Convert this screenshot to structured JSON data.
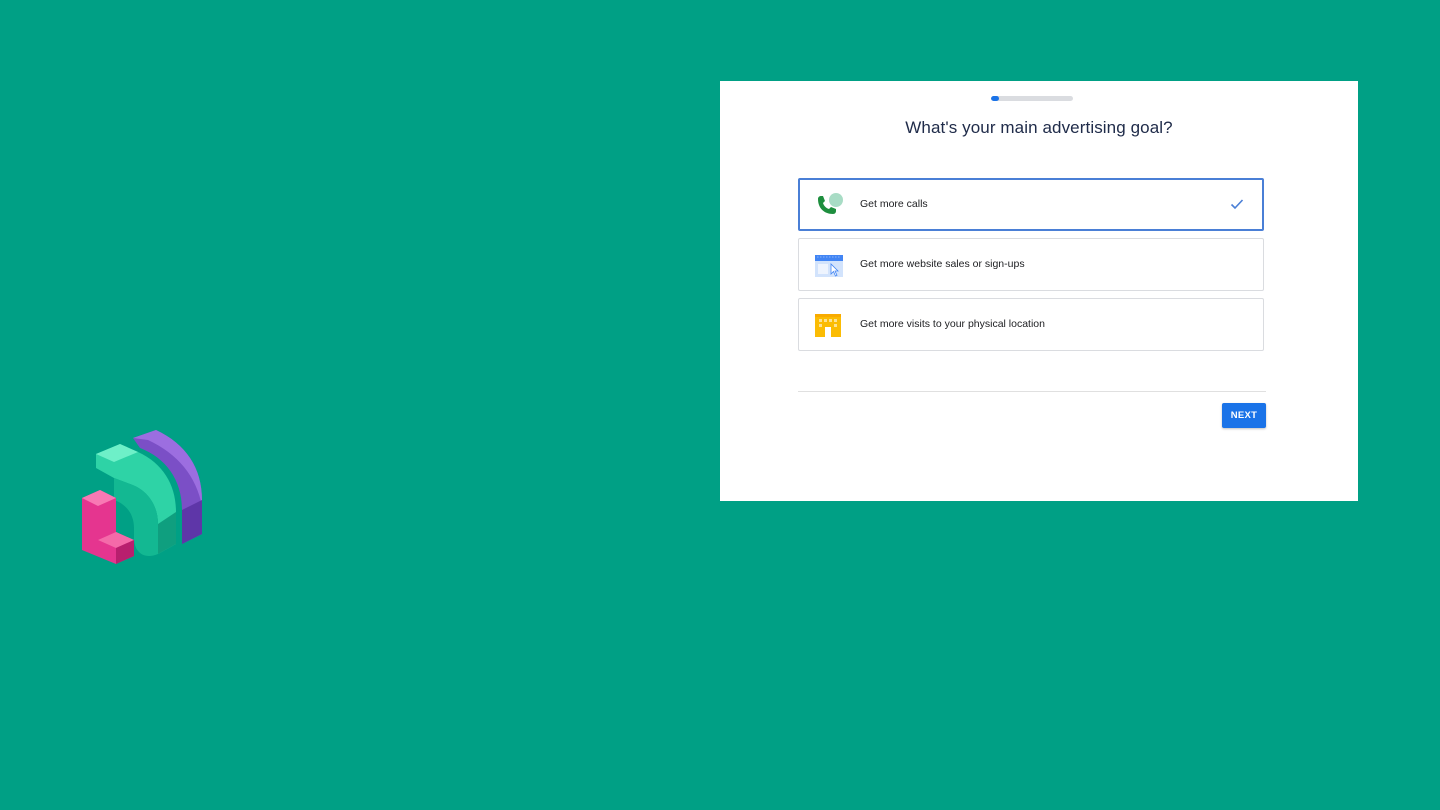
{
  "wizard": {
    "progress": 0.1,
    "question": "What's your main advertising goal?",
    "options": [
      {
        "label": "Get more calls",
        "icon": "phone-call-icon",
        "selected": true
      },
      {
        "label": "Get more website sales or sign-ups",
        "icon": "website-cursor-icon",
        "selected": false
      },
      {
        "label": "Get more visits to your physical location",
        "icon": "storefront-icon",
        "selected": false
      }
    ],
    "next_label": "NEXT"
  },
  "colors": {
    "background": "#00a085",
    "accent": "#1a73e8",
    "selected_border": "#4a7fd6"
  }
}
